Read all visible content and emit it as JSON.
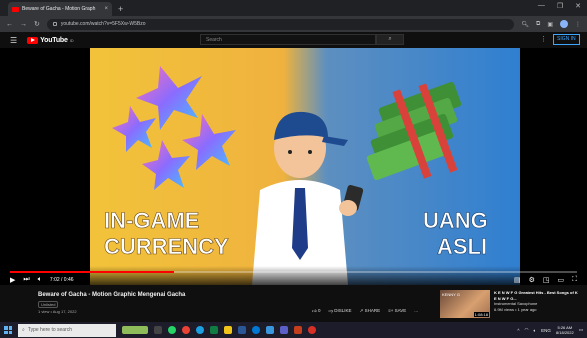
{
  "browser": {
    "tab_title": "Beware of Gacha - Motion Graph",
    "tab_close": "×",
    "new_tab": "+",
    "url": "youtube.com/watch?v=5F5Xw-W5Bzo",
    "win_min": "—",
    "win_max": "❐",
    "win_close": "✕"
  },
  "youtube": {
    "logo_text": "YouTube",
    "logo_region": "ID",
    "search_placeholder": "Search",
    "signin_label": "SIGN IN"
  },
  "video": {
    "left_text_line1": "IN-GAME",
    "left_text_line2": "CURRENCY",
    "right_text_line1": "UANG",
    "right_text_line2": "ASLI",
    "time_display": "7:02 / 0:46",
    "progress": 0.29,
    "colors": {
      "left_bg": "#f2c33a",
      "right_bg": "#2f7fd1",
      "accent": "#ff0000"
    }
  },
  "info": {
    "title": "Beware of Gacha - Motion Graphic Mengenai Gacha",
    "channel_tag": "Unlisted",
    "views_date": "1 view • Aug 17, 2022",
    "likes": "0",
    "dislike_label": "DISLIKE",
    "share_label": "SHARE",
    "save_label": "SAVE",
    "more": "..."
  },
  "recommendation": {
    "title": "K E N W F G Greatest Hits - Best Songs of K E N W F G...",
    "channel": "Instrumental Saxophone",
    "stats": "6.9M views • 1 year ago",
    "duration": "1:08:18",
    "thumb_label": "KENNY G"
  },
  "taskbar": {
    "search_placeholder": "Type here to search",
    "lang": "ENG",
    "time": "5:26 AM",
    "date": "8/18/2022"
  }
}
